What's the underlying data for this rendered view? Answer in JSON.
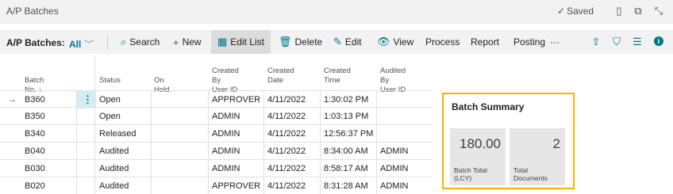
{
  "title": "A/P Batches",
  "saved": "Saved",
  "actionbar": {
    "page_label": "A/P Batches:",
    "filter": "All",
    "search": "Search",
    "new": "New",
    "edit_list": "Edit List",
    "delete": "Delete",
    "edit": "Edit",
    "view": "View",
    "process": "Process",
    "report": "Report",
    "posting": "Posting",
    "more": "···"
  },
  "table": {
    "headers": [
      {
        "l1": "Batch No. ↓",
        "l2": ""
      },
      {
        "l1": "Status",
        "l2": ""
      },
      {
        "l1": "On Hold",
        "l2": ""
      },
      {
        "l1": "Created By",
        "l2": "User ID"
      },
      {
        "l1": "Created",
        "l2": "Date"
      },
      {
        "l1": "Created",
        "l2": "Time"
      },
      {
        "l1": "Audited By",
        "l2": "User ID"
      }
    ],
    "rows": [
      {
        "batch": "B360",
        "status": "Open",
        "hold": "",
        "user": "APPROVER",
        "date": "4/11/2022",
        "time": "1:30:02 PM",
        "audited": ""
      },
      {
        "batch": "B350",
        "status": "Open",
        "hold": "",
        "user": "ADMIN",
        "date": "4/11/2022",
        "time": "1:03:13 PM",
        "audited": ""
      },
      {
        "batch": "B340",
        "status": "Released",
        "hold": "",
        "user": "ADMIN",
        "date": "4/11/2022",
        "time": "12:56:37 PM",
        "audited": ""
      },
      {
        "batch": "B040",
        "status": "Audited",
        "hold": "",
        "user": "ADMIN",
        "date": "4/11/2022",
        "time": "8:34:00 AM",
        "audited": "ADMIN"
      },
      {
        "batch": "B030",
        "status": "Audited",
        "hold": "",
        "user": "ADMIN",
        "date": "4/11/2022",
        "time": "8:58:17 AM",
        "audited": "ADMIN"
      },
      {
        "batch": "B020",
        "status": "Audited",
        "hold": "",
        "user": "APPROVER",
        "date": "4/11/2022",
        "time": "8:31:28 AM",
        "audited": "ADMIN"
      }
    ]
  },
  "summary": {
    "title": "Batch Summary",
    "total_value": "180.00",
    "total_label_1": "Batch Total",
    "total_label_2": "(LCY)",
    "docs_value": "2",
    "docs_label_1": "Total",
    "docs_label_2": "Documents"
  }
}
